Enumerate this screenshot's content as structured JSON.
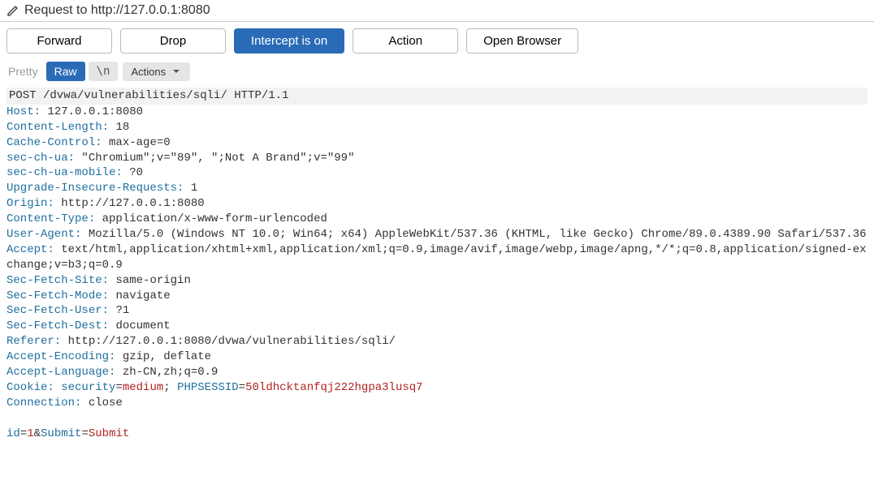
{
  "title": "Request to http://127.0.0.1:8080",
  "toolbar": {
    "forward": "Forward",
    "drop": "Drop",
    "intercept": "Intercept is on",
    "action": "Action",
    "open_browser": "Open Browser"
  },
  "viewbar": {
    "pretty": "Pretty",
    "raw": "Raw",
    "nline": "\\n",
    "actions": "Actions"
  },
  "request": {
    "first_line": "POST /dvwa/vulnerabilities/sqli/ HTTP/1.1",
    "headers": [
      {
        "name": "Host",
        "value": "127.0.0.1:8080"
      },
      {
        "name": "Content-Length",
        "value": "18"
      },
      {
        "name": "Cache-Control",
        "value": "max-age=0"
      },
      {
        "name": "sec-ch-ua",
        "value": "\"Chromium\";v=\"89\", \";Not A Brand\";v=\"99\""
      },
      {
        "name": "sec-ch-ua-mobile",
        "value": "?0"
      },
      {
        "name": "Upgrade-Insecure-Requests",
        "value": "1"
      },
      {
        "name": "Origin",
        "value": "http://127.0.0.1:8080"
      },
      {
        "name": "Content-Type",
        "value": "application/x-www-form-urlencoded"
      },
      {
        "name": "User-Agent",
        "value": "Mozilla/5.0 (Windows NT 10.0; Win64; x64) AppleWebKit/537.36 (KHTML, like Gecko) Chrome/89.0.4389.90 Safari/537.36"
      },
      {
        "name": "Accept",
        "value": "text/html,application/xhtml+xml,application/xml;q=0.9,image/avif,image/webp,image/apng,*/*;q=0.8,application/signed-exchange;v=b3;q=0.9"
      },
      {
        "name": "Sec-Fetch-Site",
        "value": "same-origin"
      },
      {
        "name": "Sec-Fetch-Mode",
        "value": "navigate"
      },
      {
        "name": "Sec-Fetch-User",
        "value": "?1"
      },
      {
        "name": "Sec-Fetch-Dest",
        "value": "document"
      },
      {
        "name": "Referer",
        "value": "http://127.0.0.1:8080/dvwa/vulnerabilities/sqli/"
      },
      {
        "name": "Accept-Encoding",
        "value": "gzip, deflate"
      },
      {
        "name": "Accept-Language",
        "value": "zh-CN,zh;q=0.9"
      }
    ],
    "cookie_header": "Cookie",
    "cookies": [
      {
        "name": "security",
        "value": "medium"
      },
      {
        "name": "PHPSESSID",
        "value": "50ldhcktanfqj222hgpa3lusq7"
      }
    ],
    "connection_header": {
      "name": "Connection",
      "value": "close"
    },
    "body_params": [
      {
        "name": "id",
        "value": "1"
      },
      {
        "name": "Submit",
        "value": "Submit"
      }
    ]
  }
}
